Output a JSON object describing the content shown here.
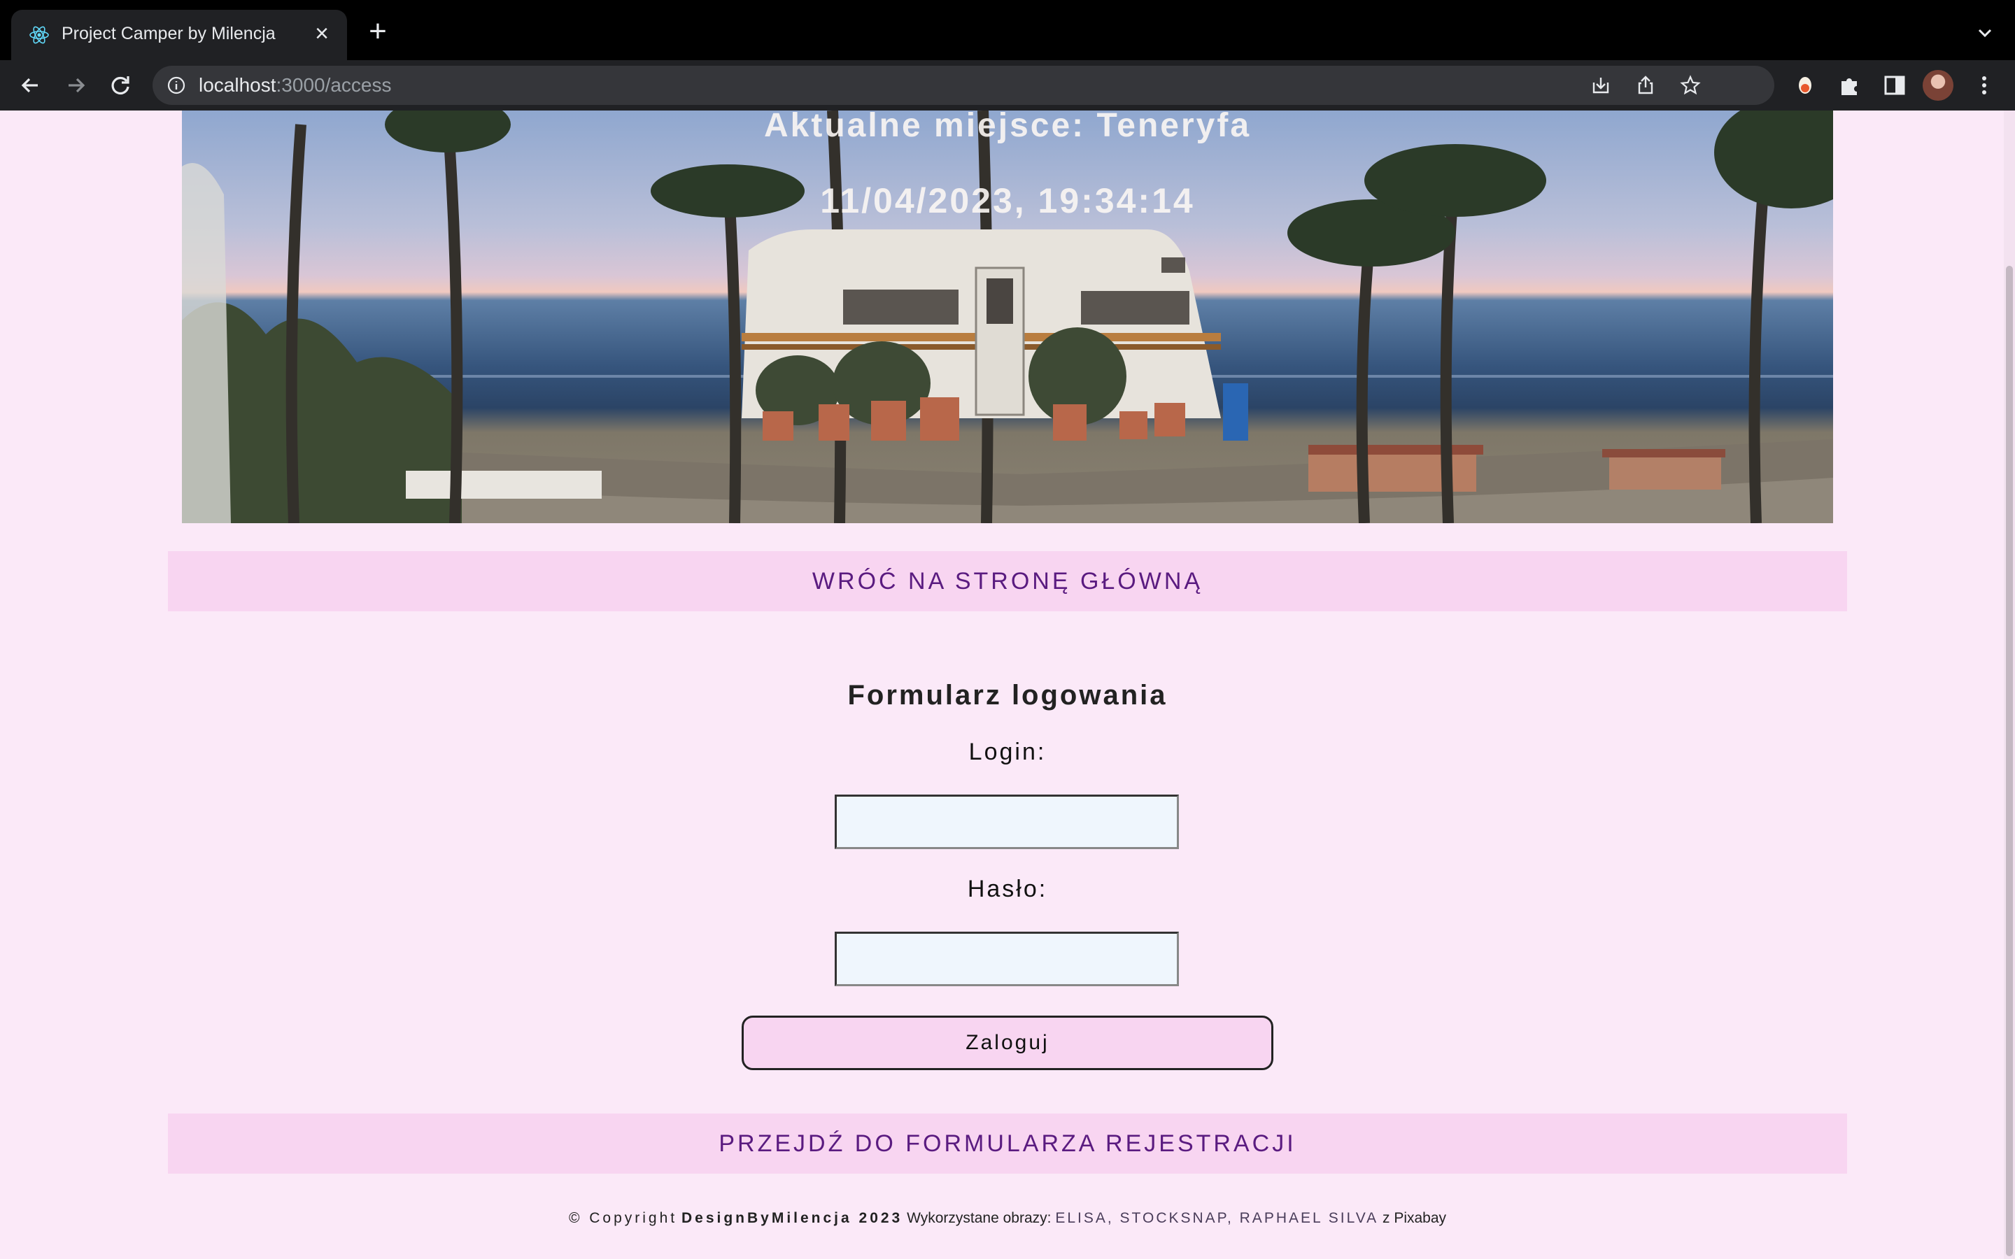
{
  "browser": {
    "tab": {
      "title": "Project Camper by Milencja",
      "favicon": "react-icon"
    },
    "url": {
      "host": "localhost",
      "path": ":3000/access"
    },
    "icons": [
      "back-icon",
      "forward-icon",
      "reload-icon",
      "info-icon",
      "download-icon",
      "share-icon",
      "star-icon",
      "extension-icon",
      "puzzle-icon",
      "sidebar-icon",
      "avatar",
      "menu-icon"
    ]
  },
  "hero": {
    "place": "Aktualne miejsce: Teneryfa",
    "datetime": "11/04/2023, 19:34:14"
  },
  "nav": {
    "back_link": "WRÓĆ NA STRONĘ GŁÓWNĄ",
    "register_link": "PRZEJDŹ DO FORMULARZA REJESTRACJI"
  },
  "login_form": {
    "title": "Formularz logowania",
    "login_label": "Login:",
    "login_value": "",
    "password_label": "Hasło:",
    "password_value": "",
    "submit_label": "Zaloguj"
  },
  "footer": {
    "copyright": "© Copyright",
    "brand": "DesignByMilencja 2023",
    "images_label": "Wykorzystane obrazy:",
    "authors": "ELISA, STOCKSNAP, RAPHAEL SILVA",
    "source": "z Pixabay"
  }
}
